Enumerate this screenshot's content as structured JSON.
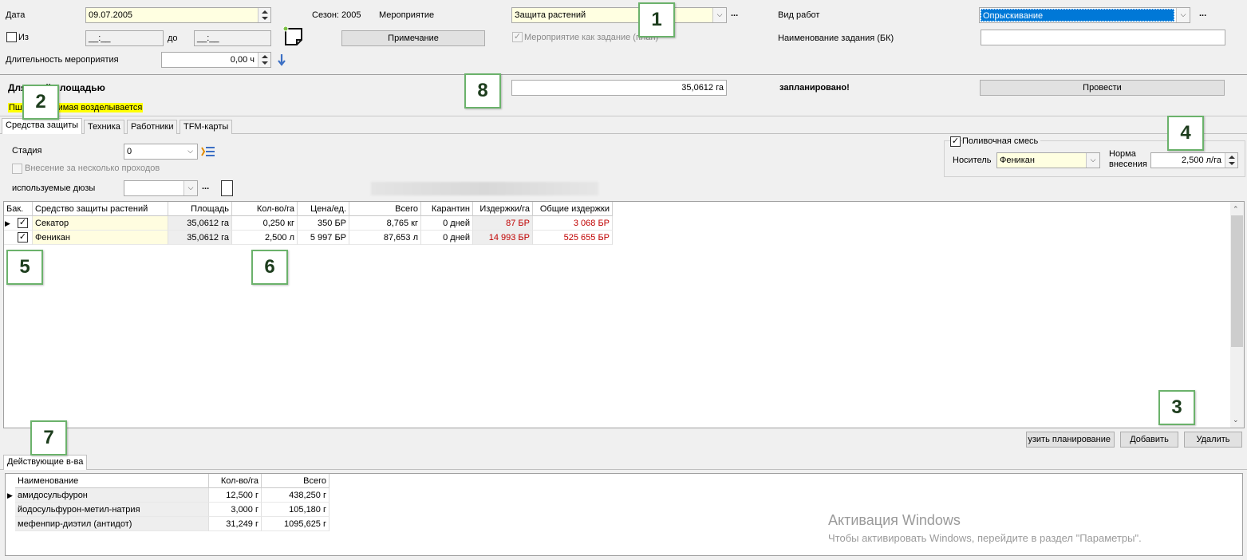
{
  "header": {
    "date_label": "Дата",
    "date_value": "09.07.2005",
    "from_label": "Из",
    "from_value": "__:__",
    "to_label": "до",
    "to_value": "__:__",
    "duration_label": "Длительность мероприятия",
    "duration_value": "0,00 ч",
    "season_label": "Сезон: 2005",
    "event_label": "Мероприятие",
    "event_value": "Защита растений",
    "event_more": "...",
    "note_button": "Примечание",
    "event_as_task_label": "Мероприятие как задание (план)",
    "work_type_label": "Вид работ",
    "work_type_value": "Опрыскивание",
    "work_type_more": "...",
    "task_name_label": "Наименование задания (БК)",
    "task_name_value": ""
  },
  "area_row": {
    "label": "Для всей площадью",
    "crop_note": "Пшеница озимая возделывается",
    "area_value": "35,0612 га",
    "status_text": "запланировано!",
    "execute_button": "Провести"
  },
  "tabs": [
    "Средства защиты",
    "Техника",
    "Работники",
    "TFM-карты"
  ],
  "protection": {
    "stage_label": "Стадия",
    "stage_value": "0",
    "multi_pass_label": "Внесение за несколько проходов",
    "nozzles_label": "используемые дюзы",
    "nozzles_value": "",
    "nozzles_more": "..."
  },
  "mix": {
    "checkbox_label": "Поливочная смесь",
    "carrier_label": "Носитель",
    "carrier_value": "Феникан",
    "rate_label_line1": "Норма",
    "rate_label_line2": "внесения",
    "rate_value": "2,500 л/га"
  },
  "main_table": {
    "columns": [
      "Бак.",
      "Средство защиты растений",
      "Площадь",
      "Кол-во/га",
      "Цена/ед.",
      "Всего",
      "Карантин",
      "Издержки/га",
      "Общие издержки"
    ],
    "rows": [
      {
        "name": "Секатор",
        "area": "35,0612 га",
        "qty": "0,250 кг",
        "price": "350 БР",
        "total": "8,765 кг",
        "quarantine": "0 дней",
        "cost_ha": "87 БР",
        "cost_total": "3 068 БР"
      },
      {
        "name": "Феникан",
        "area": "35,0612 га",
        "qty": "2,500 л",
        "price": "5 997 БР",
        "total": "87,653 л",
        "quarantine": "0 дней",
        "cost_ha": "14 993 БР",
        "cost_total": "525 655 БР"
      }
    ]
  },
  "actions": {
    "planning_button": "узить планирование",
    "add_button": "Добавить",
    "delete_button": "Удалить"
  },
  "substances": {
    "tab_label": "Действующие в-ва",
    "columns": [
      "Наименование",
      "Кол-во/га",
      "Всего"
    ],
    "rows": [
      {
        "name": "амидосульфурон",
        "qty": "12,500 г",
        "total": "438,250 г"
      },
      {
        "name": "йодосульфурон-метил-натрия",
        "qty": "3,000 г",
        "total": "105,180 г"
      },
      {
        "name": "мефенпир-диэтил (антидот)",
        "qty": "31,249 г",
        "total": "1095,625 г"
      }
    ]
  },
  "watermark": {
    "line1": "Активация Windows",
    "line2": "Чтобы активировать Windows, перейдите в раздел \"Параметры\"."
  },
  "callouts": [
    "1",
    "2",
    "3",
    "4",
    "5",
    "6",
    "7",
    "8"
  ],
  "colors": {
    "accent": "#0078d7",
    "callout_border": "#6bb26b",
    "cost_red": "#c00000",
    "highlight_yellow": "#ffff00"
  }
}
